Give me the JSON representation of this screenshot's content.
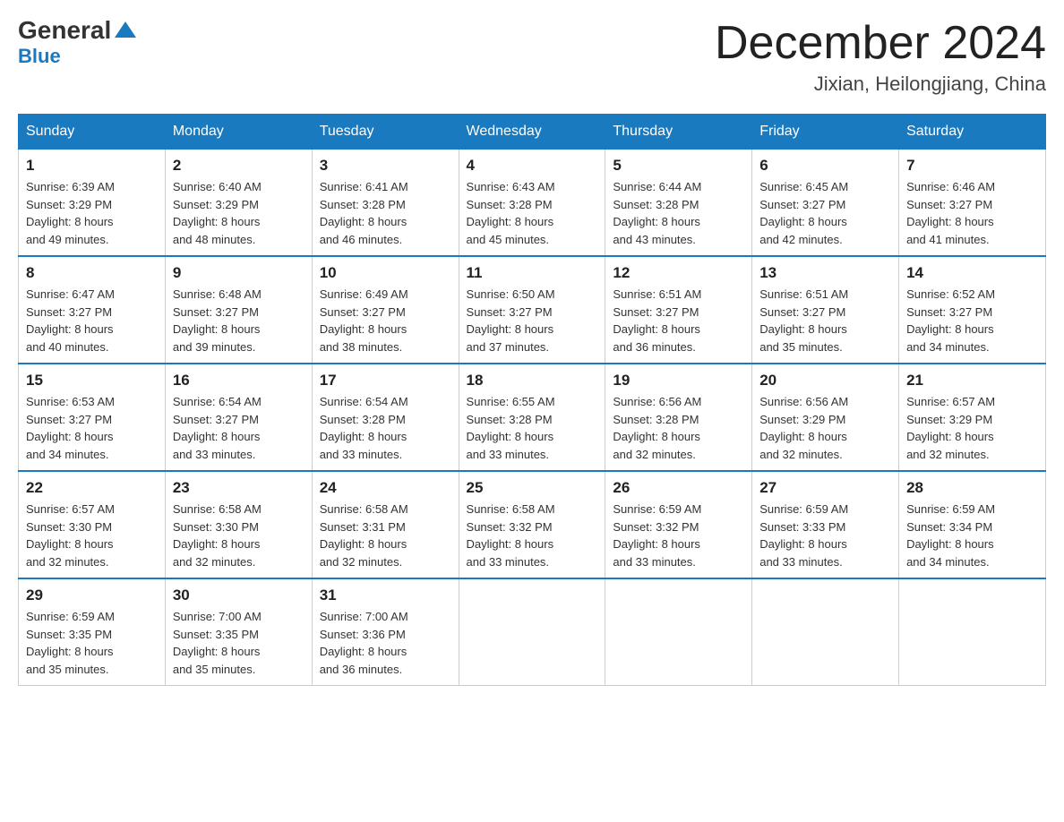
{
  "logo": {
    "text_general": "General",
    "text_blue": "Blue"
  },
  "title": "December 2024",
  "location": "Jixian, Heilongjiang, China",
  "weekdays": [
    "Sunday",
    "Monday",
    "Tuesday",
    "Wednesday",
    "Thursday",
    "Friday",
    "Saturday"
  ],
  "weeks": [
    [
      {
        "day": "1",
        "sunrise": "6:39 AM",
        "sunset": "3:29 PM",
        "daylight": "8 hours and 49 minutes."
      },
      {
        "day": "2",
        "sunrise": "6:40 AM",
        "sunset": "3:29 PM",
        "daylight": "8 hours and 48 minutes."
      },
      {
        "day": "3",
        "sunrise": "6:41 AM",
        "sunset": "3:28 PM",
        "daylight": "8 hours and 46 minutes."
      },
      {
        "day": "4",
        "sunrise": "6:43 AM",
        "sunset": "3:28 PM",
        "daylight": "8 hours and 45 minutes."
      },
      {
        "day": "5",
        "sunrise": "6:44 AM",
        "sunset": "3:28 PM",
        "daylight": "8 hours and 43 minutes."
      },
      {
        "day": "6",
        "sunrise": "6:45 AM",
        "sunset": "3:27 PM",
        "daylight": "8 hours and 42 minutes."
      },
      {
        "day": "7",
        "sunrise": "6:46 AM",
        "sunset": "3:27 PM",
        "daylight": "8 hours and 41 minutes."
      }
    ],
    [
      {
        "day": "8",
        "sunrise": "6:47 AM",
        "sunset": "3:27 PM",
        "daylight": "8 hours and 40 minutes."
      },
      {
        "day": "9",
        "sunrise": "6:48 AM",
        "sunset": "3:27 PM",
        "daylight": "8 hours and 39 minutes."
      },
      {
        "day": "10",
        "sunrise": "6:49 AM",
        "sunset": "3:27 PM",
        "daylight": "8 hours and 38 minutes."
      },
      {
        "day": "11",
        "sunrise": "6:50 AM",
        "sunset": "3:27 PM",
        "daylight": "8 hours and 37 minutes."
      },
      {
        "day": "12",
        "sunrise": "6:51 AM",
        "sunset": "3:27 PM",
        "daylight": "8 hours and 36 minutes."
      },
      {
        "day": "13",
        "sunrise": "6:51 AM",
        "sunset": "3:27 PM",
        "daylight": "8 hours and 35 minutes."
      },
      {
        "day": "14",
        "sunrise": "6:52 AM",
        "sunset": "3:27 PM",
        "daylight": "8 hours and 34 minutes."
      }
    ],
    [
      {
        "day": "15",
        "sunrise": "6:53 AM",
        "sunset": "3:27 PM",
        "daylight": "8 hours and 34 minutes."
      },
      {
        "day": "16",
        "sunrise": "6:54 AM",
        "sunset": "3:27 PM",
        "daylight": "8 hours and 33 minutes."
      },
      {
        "day": "17",
        "sunrise": "6:54 AM",
        "sunset": "3:28 PM",
        "daylight": "8 hours and 33 minutes."
      },
      {
        "day": "18",
        "sunrise": "6:55 AM",
        "sunset": "3:28 PM",
        "daylight": "8 hours and 33 minutes."
      },
      {
        "day": "19",
        "sunrise": "6:56 AM",
        "sunset": "3:28 PM",
        "daylight": "8 hours and 32 minutes."
      },
      {
        "day": "20",
        "sunrise": "6:56 AM",
        "sunset": "3:29 PM",
        "daylight": "8 hours and 32 minutes."
      },
      {
        "day": "21",
        "sunrise": "6:57 AM",
        "sunset": "3:29 PM",
        "daylight": "8 hours and 32 minutes."
      }
    ],
    [
      {
        "day": "22",
        "sunrise": "6:57 AM",
        "sunset": "3:30 PM",
        "daylight": "8 hours and 32 minutes."
      },
      {
        "day": "23",
        "sunrise": "6:58 AM",
        "sunset": "3:30 PM",
        "daylight": "8 hours and 32 minutes."
      },
      {
        "day": "24",
        "sunrise": "6:58 AM",
        "sunset": "3:31 PM",
        "daylight": "8 hours and 32 minutes."
      },
      {
        "day": "25",
        "sunrise": "6:58 AM",
        "sunset": "3:32 PM",
        "daylight": "8 hours and 33 minutes."
      },
      {
        "day": "26",
        "sunrise": "6:59 AM",
        "sunset": "3:32 PM",
        "daylight": "8 hours and 33 minutes."
      },
      {
        "day": "27",
        "sunrise": "6:59 AM",
        "sunset": "3:33 PM",
        "daylight": "8 hours and 33 minutes."
      },
      {
        "day": "28",
        "sunrise": "6:59 AM",
        "sunset": "3:34 PM",
        "daylight": "8 hours and 34 minutes."
      }
    ],
    [
      {
        "day": "29",
        "sunrise": "6:59 AM",
        "sunset": "3:35 PM",
        "daylight": "8 hours and 35 minutes."
      },
      {
        "day": "30",
        "sunrise": "7:00 AM",
        "sunset": "3:35 PM",
        "daylight": "8 hours and 35 minutes."
      },
      {
        "day": "31",
        "sunrise": "7:00 AM",
        "sunset": "3:36 PM",
        "daylight": "8 hours and 36 minutes."
      },
      null,
      null,
      null,
      null
    ]
  ],
  "labels": {
    "sunrise": "Sunrise:",
    "sunset": "Sunset:",
    "daylight": "Daylight:"
  }
}
